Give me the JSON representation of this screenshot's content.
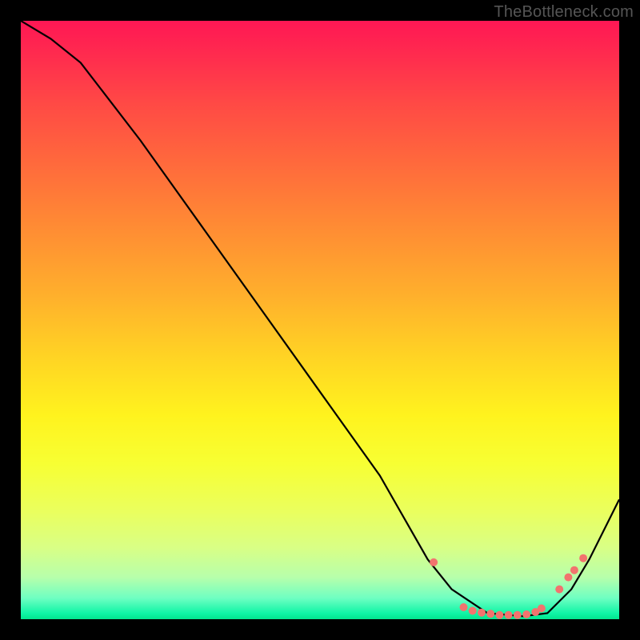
{
  "watermark": "TheBottleneck.com",
  "chart_data": {
    "type": "line",
    "title": "",
    "xlabel": "",
    "ylabel": "",
    "xlim": [
      0,
      100
    ],
    "ylim": [
      0,
      100
    ],
    "grid": false,
    "series": [
      {
        "name": "curve",
        "x": [
          0,
          5,
          10,
          20,
          30,
          40,
          50,
          60,
          68,
          72,
          78,
          84,
          88,
          92,
          95,
          100
        ],
        "y": [
          100,
          97,
          93,
          80,
          66,
          52,
          38,
          24,
          10,
          5,
          1,
          0.5,
          1,
          5,
          10,
          20
        ]
      }
    ],
    "markers": {
      "name": "dots",
      "color": "#f2736e",
      "points_x": [
        69,
        74,
        75.5,
        77,
        78.5,
        80,
        81.5,
        83,
        84.5,
        86,
        87,
        90,
        91.5,
        92.5,
        94
      ],
      "points_y": [
        9.5,
        2.0,
        1.4,
        1.1,
        0.9,
        0.7,
        0.7,
        0.7,
        0.8,
        1.2,
        1.8,
        5.0,
        7.0,
        8.2,
        10.2
      ]
    },
    "background": {
      "type": "vertical-gradient",
      "stops": [
        {
          "pos": 0.0,
          "color": "#ff1754"
        },
        {
          "pos": 0.24,
          "color": "#ff6a3c"
        },
        {
          "pos": 0.56,
          "color": "#ffd324"
        },
        {
          "pos": 0.82,
          "color": "#eaff5e"
        },
        {
          "pos": 0.97,
          "color": "#6effc2"
        },
        {
          "pos": 1.0,
          "color": "#02e58e"
        }
      ]
    }
  }
}
